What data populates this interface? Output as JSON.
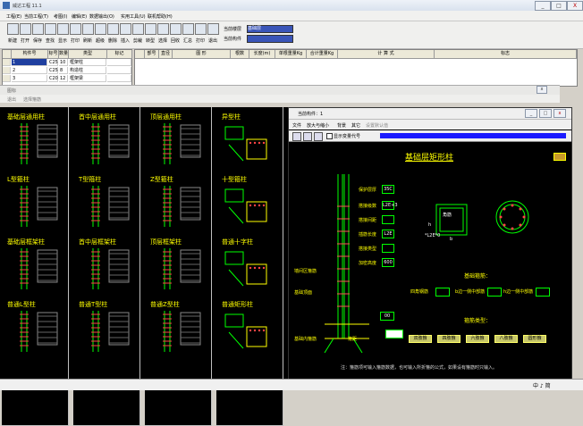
{
  "app": {
    "title": "威达工程 11.1",
    "controls": [
      "_",
      "□",
      "X"
    ]
  },
  "menu": [
    "工程(E)",
    "当前工程(T)",
    "考图(I)",
    "编辑(E)",
    "数据输出(O)",
    "实用工具(U)",
    "联机帮助(H)"
  ],
  "toolbar": {
    "buttons": [
      {
        "label": "新建",
        "icon": "new-file-icon"
      },
      {
        "label": "打开",
        "icon": "open-folder-icon"
      },
      {
        "label": "保存",
        "icon": "save-icon"
      },
      {
        "label": "查找",
        "icon": "find-icon"
      },
      {
        "label": "显示",
        "icon": "display-icon"
      },
      {
        "label": "打印",
        "icon": "print-icon"
      },
      {
        "label": "刷新",
        "icon": "refresh-icon"
      },
      {
        "label": "超级",
        "icon": "super-icon"
      },
      {
        "label": "删除",
        "icon": "delete-icon"
      },
      {
        "label": "插入",
        "icon": "insert-icon"
      },
      {
        "label": "剪裁",
        "icon": "cut-icon"
      },
      {
        "label": "转型",
        "icon": "convert-icon"
      },
      {
        "label": "选择",
        "icon": "select-icon"
      },
      {
        "label": "回收",
        "icon": "recycle-icon"
      },
      {
        "label": "汇总",
        "icon": "sum-icon"
      },
      {
        "label": "打印",
        "icon": "print2-icon"
      },
      {
        "label": "退出",
        "icon": "exit-icon"
      }
    ],
    "current_project_label": "当前楼层",
    "current_project_value": "基础层",
    "current_member_label": "当前构件",
    "current_member_value": ""
  },
  "left_grid": {
    "headers": [
      "构件号",
      "标号",
      "数量",
      "类型",
      "标记"
    ],
    "rows": [
      [
        "1",
        "C25",
        "10",
        "框架柱",
        ""
      ],
      [
        "2",
        "C25",
        "8",
        "构造柱",
        ""
      ],
      [
        "3",
        "C20",
        "12",
        "框架梁",
        ""
      ]
    ]
  },
  "right_grid": {
    "headers": [
      "部号",
      "直径",
      "图  形",
      "根数",
      "长度(m)",
      "单根重量Kg",
      "合计重量Kg",
      "计    算    式",
      "标志"
    ]
  },
  "gallery": {
    "title": "图标",
    "menu": [
      "退出",
      "选择箍筋"
    ],
    "items": [
      "基础层通用柱",
      "首中层通用柱",
      "顶层通用柱",
      "异型柱",
      "L型箍柱",
      "T型箍柱",
      "Z型箍柱",
      "十型箍柱",
      "基础层框架柱",
      "首中层框架柱",
      "顶层框架柱",
      "普通十字柱",
      "普通L型柱",
      "普通T型柱",
      "普通Z型柱",
      "普通矩形柱",
      "",
      "",
      "",
      ""
    ]
  },
  "dialog": {
    "title": "当前构件：1",
    "menu": [
      "文件",
      "放大与缩小",
      "背景",
      "其它",
      "设置默认值"
    ],
    "checkbox_label": "显示变量代号",
    "drawing_title": "基础层矩形柱",
    "fields": [
      {
        "label": "保护层厚",
        "value": "35C"
      },
      {
        "label": "搭接级数",
        "value": "L2E+3"
      },
      {
        "label": "搭接间距",
        "value": ""
      },
      {
        "label": "插筋长度",
        "value": "L2E"
      },
      {
        "label": "搭接类型",
        "value": ""
      },
      {
        "label": "加密高度",
        "value": "600"
      }
    ],
    "left_labels": [
      "墙间区箍筋",
      "基础顶面",
      "基础内箍筋",
      "箍距"
    ],
    "left_values": [
      "",
      "00"
    ],
    "dimension_label": "*L2E*0",
    "section_labels": [
      "角筋",
      "b",
      "h"
    ],
    "basic_bars_title": "基础箍筋：",
    "basic_bars": [
      "四角钢筋",
      "b边一侧中部筋",
      "h边一侧中部筋"
    ],
    "stirrup_title": "箍筋类型：",
    "stirrup_types": [
      "双肢箍",
      "四肢箍",
      "六肢箍",
      "八肢箍",
      "圆形箍"
    ],
    "note": "注：箍筋项可输入箍筋数据，也可输入所折箍的公式，如果设有箍筋时只输入。",
    "colors": {
      "line": "#00ff00",
      "text": "#ffff00",
      "title": "#ffff00",
      "box": "#ffffff"
    }
  },
  "status": {
    "clock": "中 ♪ 简"
  }
}
